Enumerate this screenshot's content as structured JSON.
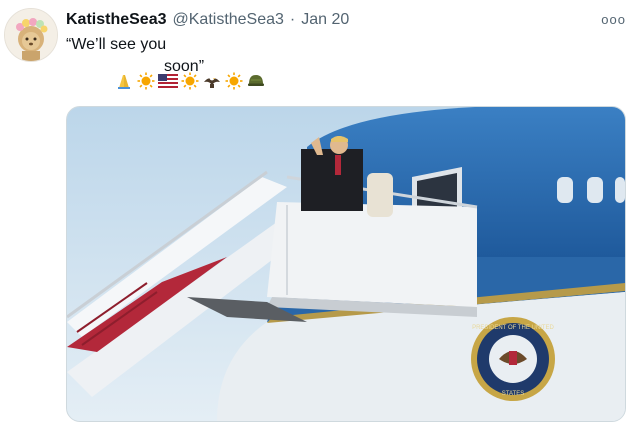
{
  "tweet": {
    "display_name": "KatistheSea3",
    "handle": "@KatistheSea3",
    "separator": "·",
    "date": "Jan 20",
    "text_line1": "“We’ll see you",
    "text_line2": "soon”",
    "emojis": [
      "praying-hands",
      "sun",
      "us-flag",
      "sun",
      "eagle",
      "sun",
      "military-helmet"
    ],
    "more_label": "ooo"
  },
  "photo": {
    "seal_text_top": "PRESIDENT OF THE UNITED",
    "seal_text_bottom": "STATES",
    "colors": {
      "sky": "#cfe1ee",
      "fuselage_blue": "#2f6fb3",
      "fuselage_white": "#e9eef2",
      "stairs": "#f1f3f5",
      "carpet": "#b3283a"
    }
  }
}
